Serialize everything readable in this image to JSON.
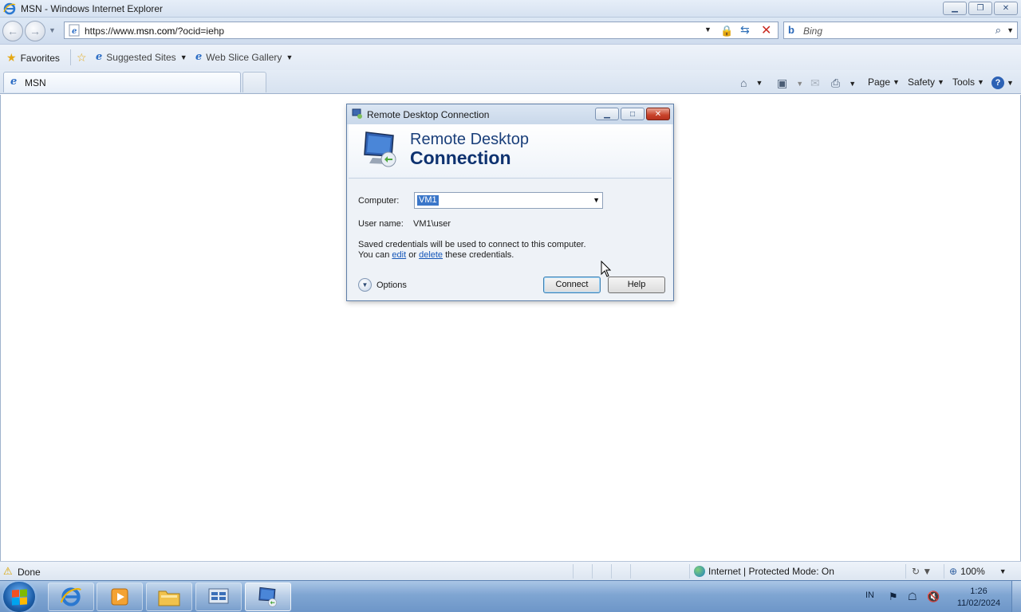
{
  "browser": {
    "window_title": "MSN - Windows Internet Explorer",
    "url_prefix": "https://www.",
    "url_domain": "msn.com",
    "url_rest": "/?ocid=iehp",
    "search_placeholder": "Bing",
    "favorites_label": "Favorites",
    "suggested_sites_label": "Suggested Sites",
    "web_slice_label": "Web Slice Gallery",
    "tab_label": "MSN",
    "commands": {
      "page": "Page",
      "safety": "Safety",
      "tools": "Tools"
    },
    "status_text": "Done",
    "zone_text": "Internet | Protected Mode: On",
    "zoom": "100%"
  },
  "dialog": {
    "title": "Remote Desktop Connection",
    "banner_line1": "Remote Desktop",
    "banner_line2": "Connection",
    "computer_label": "Computer:",
    "computer_value": "VM1",
    "username_label": "User name:",
    "username_value": "VM1\\user",
    "info_line1": "Saved credentials will be used to connect to this computer.",
    "info_line2_pre": "You can ",
    "edit_link": "edit",
    "info_line2_mid": " or ",
    "delete_link": "delete",
    "info_line2_post": " these credentials.",
    "options_label": "Options",
    "connect_label": "Connect",
    "help_label": "Help"
  },
  "taskbar": {
    "language": "IN",
    "time": "1:26",
    "date": "11/02/2024"
  },
  "colors": {
    "accent": "#1a3f7a",
    "link": "#1556b8",
    "selection": "#3a76c9",
    "close_button": "#c8432b"
  },
  "icons": [
    "ie-icon",
    "back-icon",
    "forward-icon",
    "lock-icon",
    "refresh-icon",
    "stop-icon",
    "bing-icon",
    "search-icon",
    "favorites-star-icon",
    "home-icon",
    "feeds-icon",
    "mail-icon",
    "print-icon",
    "help-icon",
    "warning-icon",
    "globe-icon",
    "zoom-icon",
    "start-orb-icon",
    "rdc-monitor-icon",
    "cursor-icon"
  ]
}
